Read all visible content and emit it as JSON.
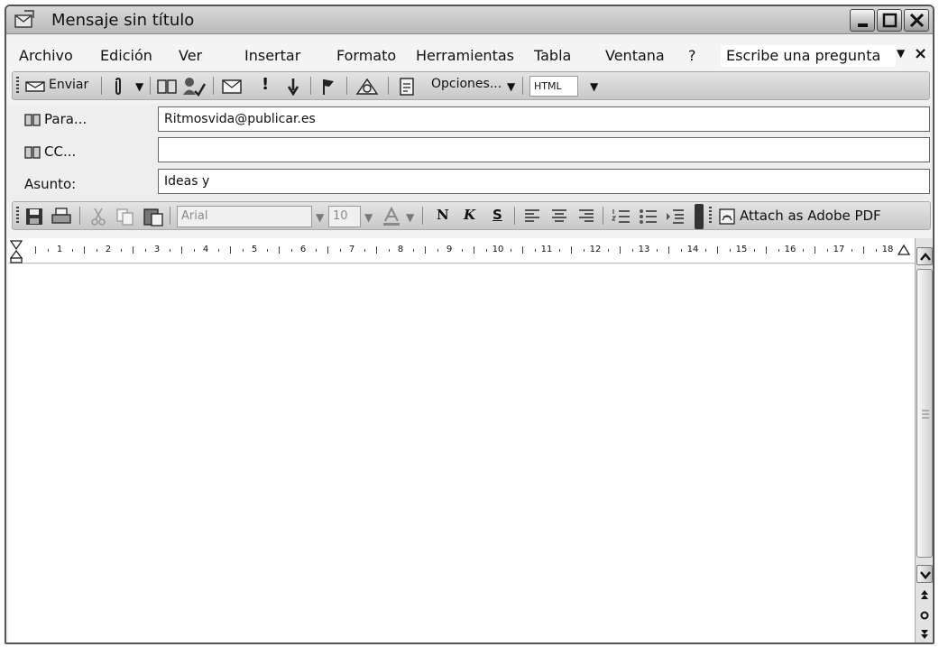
{
  "window": {
    "title": "Mensaje sin título"
  },
  "menubar": {
    "items": [
      {
        "label": "Archivo"
      },
      {
        "label": "Edición"
      },
      {
        "label": "Ver"
      },
      {
        "label": "Insertar"
      },
      {
        "label": "Formato"
      },
      {
        "label": "Herramientas"
      },
      {
        "label": "Tabla"
      },
      {
        "label": "Ventana"
      },
      {
        "label": "?"
      }
    ],
    "ask_placeholder": "Escribe una pregunta"
  },
  "standard_toolbar": {
    "send_label": "Enviar",
    "options_label": "Opciones...",
    "format_value": "HTML"
  },
  "header": {
    "to_label": "Para...",
    "to_value": "Ritmosvida@publicar.es",
    "cc_label": "CC...",
    "cc_value": "",
    "subject_label": "Asunto:",
    "subject_value": "Ideas y"
  },
  "format_toolbar": {
    "font_name": "Arial",
    "font_size": "10",
    "bold_label": "N",
    "italic_label": "K",
    "underline_label": "S",
    "attach_pdf_label": "Attach as Adobe PDF"
  },
  "ruler": {
    "ticks": [
      "1",
      "2",
      "3",
      "4",
      "5",
      "6",
      "7",
      "8",
      "9",
      "10",
      "11",
      "12",
      "13",
      "14",
      "15",
      "16",
      "17",
      "18"
    ]
  },
  "colors": {
    "title_bar": "#c8c8c8",
    "toolbar": "#d6d6d6",
    "header_background": "#eeeeee"
  }
}
